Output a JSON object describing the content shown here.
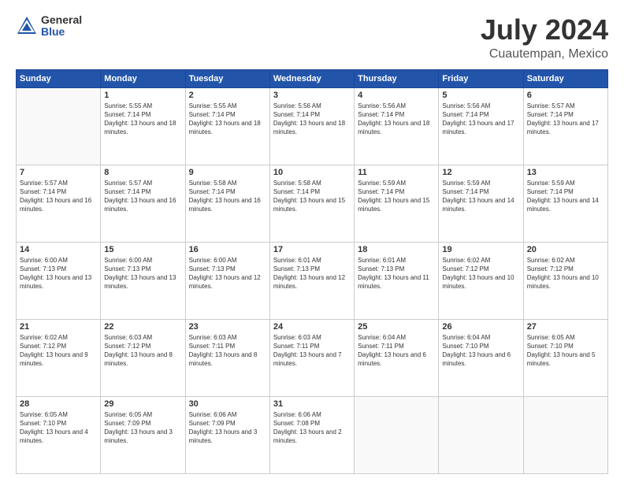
{
  "header": {
    "logo_general": "General",
    "logo_blue": "Blue",
    "title": "July 2024",
    "location": "Cuautempan, Mexico"
  },
  "columns": [
    "Sunday",
    "Monday",
    "Tuesday",
    "Wednesday",
    "Thursday",
    "Friday",
    "Saturday"
  ],
  "weeks": [
    [
      {
        "day": "",
        "sunrise": "",
        "sunset": "",
        "daylight": ""
      },
      {
        "day": "1",
        "sunrise": "Sunrise: 5:55 AM",
        "sunset": "Sunset: 7:14 PM",
        "daylight": "Daylight: 13 hours and 18 minutes."
      },
      {
        "day": "2",
        "sunrise": "Sunrise: 5:55 AM",
        "sunset": "Sunset: 7:14 PM",
        "daylight": "Daylight: 13 hours and 18 minutes."
      },
      {
        "day": "3",
        "sunrise": "Sunrise: 5:56 AM",
        "sunset": "Sunset: 7:14 PM",
        "daylight": "Daylight: 13 hours and 18 minutes."
      },
      {
        "day": "4",
        "sunrise": "Sunrise: 5:56 AM",
        "sunset": "Sunset: 7:14 PM",
        "daylight": "Daylight: 13 hours and 18 minutes."
      },
      {
        "day": "5",
        "sunrise": "Sunrise: 5:56 AM",
        "sunset": "Sunset: 7:14 PM",
        "daylight": "Daylight: 13 hours and 17 minutes."
      },
      {
        "day": "6",
        "sunrise": "Sunrise: 5:57 AM",
        "sunset": "Sunset: 7:14 PM",
        "daylight": "Daylight: 13 hours and 17 minutes."
      }
    ],
    [
      {
        "day": "7",
        "sunrise": "Sunrise: 5:57 AM",
        "sunset": "Sunset: 7:14 PM",
        "daylight": "Daylight: 13 hours and 16 minutes."
      },
      {
        "day": "8",
        "sunrise": "Sunrise: 5:57 AM",
        "sunset": "Sunset: 7:14 PM",
        "daylight": "Daylight: 13 hours and 16 minutes."
      },
      {
        "day": "9",
        "sunrise": "Sunrise: 5:58 AM",
        "sunset": "Sunset: 7:14 PM",
        "daylight": "Daylight: 13 hours and 16 minutes."
      },
      {
        "day": "10",
        "sunrise": "Sunrise: 5:58 AM",
        "sunset": "Sunset: 7:14 PM",
        "daylight": "Daylight: 13 hours and 15 minutes."
      },
      {
        "day": "11",
        "sunrise": "Sunrise: 5:59 AM",
        "sunset": "Sunset: 7:14 PM",
        "daylight": "Daylight: 13 hours and 15 minutes."
      },
      {
        "day": "12",
        "sunrise": "Sunrise: 5:59 AM",
        "sunset": "Sunset: 7:14 PM",
        "daylight": "Daylight: 13 hours and 14 minutes."
      },
      {
        "day": "13",
        "sunrise": "Sunrise: 5:59 AM",
        "sunset": "Sunset: 7:14 PM",
        "daylight": "Daylight: 13 hours and 14 minutes."
      }
    ],
    [
      {
        "day": "14",
        "sunrise": "Sunrise: 6:00 AM",
        "sunset": "Sunset: 7:13 PM",
        "daylight": "Daylight: 13 hours and 13 minutes."
      },
      {
        "day": "15",
        "sunrise": "Sunrise: 6:00 AM",
        "sunset": "Sunset: 7:13 PM",
        "daylight": "Daylight: 13 hours and 13 minutes."
      },
      {
        "day": "16",
        "sunrise": "Sunrise: 6:00 AM",
        "sunset": "Sunset: 7:13 PM",
        "daylight": "Daylight: 13 hours and 12 minutes."
      },
      {
        "day": "17",
        "sunrise": "Sunrise: 6:01 AM",
        "sunset": "Sunset: 7:13 PM",
        "daylight": "Daylight: 13 hours and 12 minutes."
      },
      {
        "day": "18",
        "sunrise": "Sunrise: 6:01 AM",
        "sunset": "Sunset: 7:13 PM",
        "daylight": "Daylight: 13 hours and 11 minutes."
      },
      {
        "day": "19",
        "sunrise": "Sunrise: 6:02 AM",
        "sunset": "Sunset: 7:12 PM",
        "daylight": "Daylight: 13 hours and 10 minutes."
      },
      {
        "day": "20",
        "sunrise": "Sunrise: 6:02 AM",
        "sunset": "Sunset: 7:12 PM",
        "daylight": "Daylight: 13 hours and 10 minutes."
      }
    ],
    [
      {
        "day": "21",
        "sunrise": "Sunrise: 6:02 AM",
        "sunset": "Sunset: 7:12 PM",
        "daylight": "Daylight: 13 hours and 9 minutes."
      },
      {
        "day": "22",
        "sunrise": "Sunrise: 6:03 AM",
        "sunset": "Sunset: 7:12 PM",
        "daylight": "Daylight: 13 hours and 8 minutes."
      },
      {
        "day": "23",
        "sunrise": "Sunrise: 6:03 AM",
        "sunset": "Sunset: 7:11 PM",
        "daylight": "Daylight: 13 hours and 8 minutes."
      },
      {
        "day": "24",
        "sunrise": "Sunrise: 6:03 AM",
        "sunset": "Sunset: 7:11 PM",
        "daylight": "Daylight: 13 hours and 7 minutes."
      },
      {
        "day": "25",
        "sunrise": "Sunrise: 6:04 AM",
        "sunset": "Sunset: 7:11 PM",
        "daylight": "Daylight: 13 hours and 6 minutes."
      },
      {
        "day": "26",
        "sunrise": "Sunrise: 6:04 AM",
        "sunset": "Sunset: 7:10 PM",
        "daylight": "Daylight: 13 hours and 6 minutes."
      },
      {
        "day": "27",
        "sunrise": "Sunrise: 6:05 AM",
        "sunset": "Sunset: 7:10 PM",
        "daylight": "Daylight: 13 hours and 5 minutes."
      }
    ],
    [
      {
        "day": "28",
        "sunrise": "Sunrise: 6:05 AM",
        "sunset": "Sunset: 7:10 PM",
        "daylight": "Daylight: 13 hours and 4 minutes."
      },
      {
        "day": "29",
        "sunrise": "Sunrise: 6:05 AM",
        "sunset": "Sunset: 7:09 PM",
        "daylight": "Daylight: 13 hours and 3 minutes."
      },
      {
        "day": "30",
        "sunrise": "Sunrise: 6:06 AM",
        "sunset": "Sunset: 7:09 PM",
        "daylight": "Daylight: 13 hours and 3 minutes."
      },
      {
        "day": "31",
        "sunrise": "Sunrise: 6:06 AM",
        "sunset": "Sunset: 7:08 PM",
        "daylight": "Daylight: 13 hours and 2 minutes."
      },
      {
        "day": "",
        "sunrise": "",
        "sunset": "",
        "daylight": ""
      },
      {
        "day": "",
        "sunrise": "",
        "sunset": "",
        "daylight": ""
      },
      {
        "day": "",
        "sunrise": "",
        "sunset": "",
        "daylight": ""
      }
    ]
  ]
}
